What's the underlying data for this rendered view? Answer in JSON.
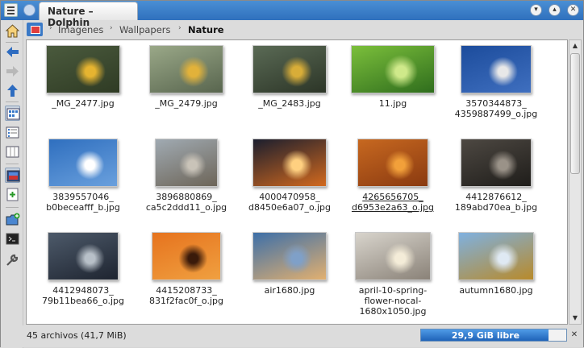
{
  "window": {
    "title": "Nature – Dolphin",
    "buttons": {
      "minimize": "▾",
      "maximize": "▴",
      "close": "✕"
    }
  },
  "breadcrumb": {
    "parts": [
      "Imagenes",
      "Wallpapers"
    ],
    "current": "Nature",
    "separator": "›"
  },
  "files": [
    {
      "name": "_MG_2477.jpg",
      "colors": [
        "#4a5a3d",
        "#2f3b24",
        "#e6b430"
      ]
    },
    {
      "name": "_MG_2479.jpg",
      "colors": [
        "#9aa888",
        "#58654e",
        "#e2b23a"
      ]
    },
    {
      "name": "_MG_2483.jpg",
      "colors": [
        "#5a6a55",
        "#2c3527",
        "#d8ad38"
      ]
    },
    {
      "name": "11.jpg",
      "colors": [
        "#7bbf3b",
        "#2f6d1d",
        "#cfe98a"
      ]
    },
    {
      "name": "3570344873_\n4359887499_o.jpg",
      "colors": [
        "#1c4c9c",
        "#3f6fbf",
        "#e8e8e8"
      ]
    },
    {
      "name": "3839557046_\nb0beceafff_b.jpg",
      "colors": [
        "#2f6fbf",
        "#6aa0dd",
        "#ffffff"
      ]
    },
    {
      "name": "3896880869_\nca5c2ddd11_o.jpg",
      "colors": [
        "#a0aab2",
        "#6d6558",
        "#c9c3b8"
      ]
    },
    {
      "name": "4000470958_\nd8450e6a07_o.jpg",
      "colors": [
        "#1b1e2e",
        "#d2691e",
        "#ffd080"
      ]
    },
    {
      "name": "4265656705_\nd6953e2a63_o.jpg",
      "colors": [
        "#c76820",
        "#8a3a10",
        "#f2a03a"
      ]
    },
    {
      "name": "4412876612_\n189abd70ea_b.jpg",
      "colors": [
        "#4d4842",
        "#1f1d1a",
        "#9a9288"
      ]
    },
    {
      "name": "4412948073_\n79b11bea66_o.jpg",
      "colors": [
        "#4d5a6a",
        "#1e2430",
        "#b8c0c8"
      ]
    },
    {
      "name": "4415208733_\n831f2fac0f_o.jpg",
      "colors": [
        "#e6731e",
        "#f0a040",
        "#3a1a0a"
      ]
    },
    {
      "name": "air1680.jpg",
      "colors": [
        "#3d6fa8",
        "#e2b070",
        "#7fa0c8"
      ]
    },
    {
      "name": "april-10-spring-\nflower-nocal-\n1680x1050.jpg",
      "colors": [
        "#d8d4cc",
        "#8a8278",
        "#f4ecd8"
      ]
    },
    {
      "name": "autumn1680.jpg",
      "colors": [
        "#7fb1e0",
        "#b88a2a",
        "#dfe9f3"
      ]
    }
  ],
  "status": {
    "text": "45 archivos (41,7 MiB)",
    "free_space": "29,9 GiB libre",
    "used_fraction": 0.88
  },
  "icons": {
    "home": "home-icon",
    "back": "back-arrow-icon",
    "forward": "forward-arrow-icon",
    "up": "up-arrow-icon"
  }
}
